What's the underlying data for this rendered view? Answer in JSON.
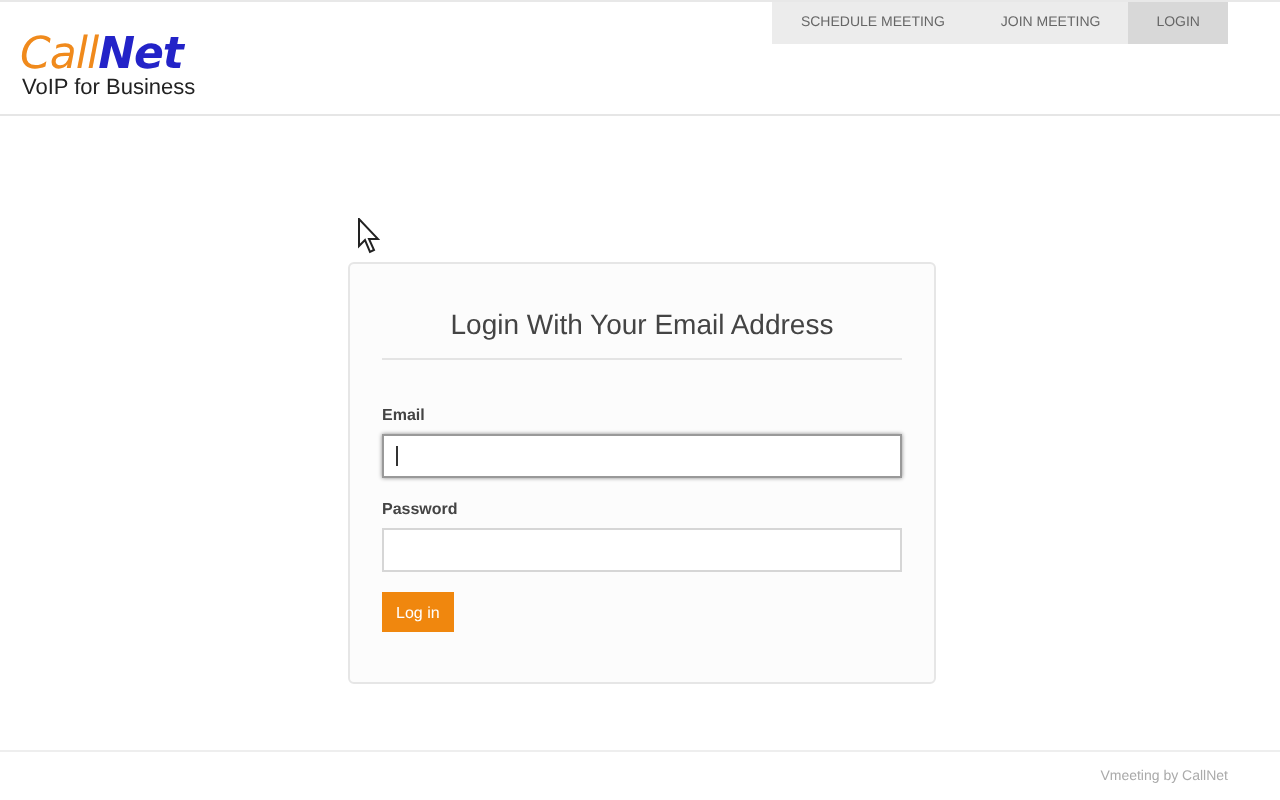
{
  "logo": {
    "word_1": "Call",
    "word_2": "Net",
    "tagline": "VoIP for Business"
  },
  "nav": [
    {
      "label": "SCHEDULE MEETING",
      "selected": false
    },
    {
      "label": "JOIN MEETING",
      "selected": false
    },
    {
      "label": "LOGIN",
      "selected": true
    }
  ],
  "login": {
    "title": "Login With Your Email Address",
    "fields": [
      {
        "label": "Email",
        "focused": true
      },
      {
        "label": "Password",
        "focused": false
      }
    ],
    "button": "Log in"
  },
  "footer": "Vmeeting by CallNet"
}
